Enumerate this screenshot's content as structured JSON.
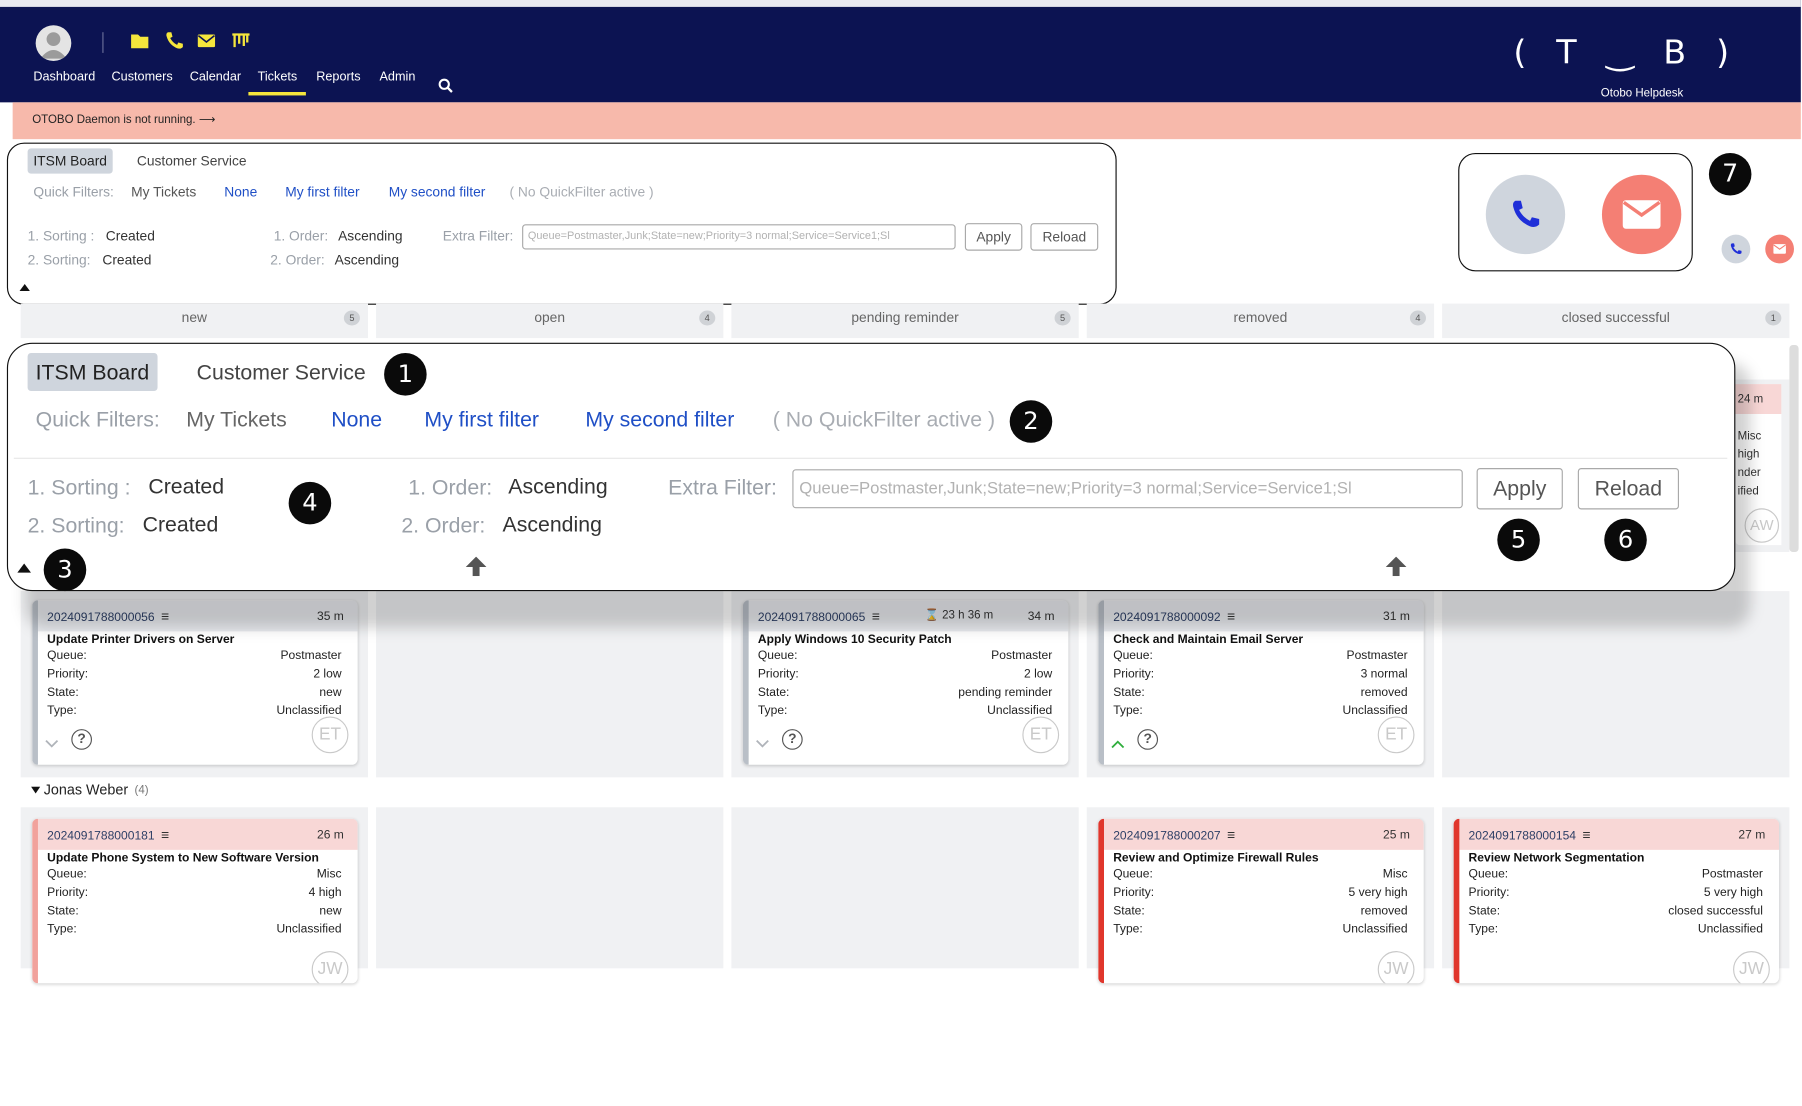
{
  "header": {
    "nav": [
      "Dashboard",
      "Customers",
      "Calendar",
      "Tickets",
      "Reports",
      "Admin"
    ],
    "active_nav": "Tickets",
    "logo_text": "(T‿B)",
    "brand": "Otobo Helpdesk"
  },
  "notice": "OTOBO Daemon is not running. ⟶",
  "toolbar": {
    "tabs": [
      "ITSM Board",
      "Customer Service"
    ],
    "quick_filters_label": "Quick Filters:",
    "quick_filters": [
      "My Tickets",
      "None",
      "My first filter",
      "My second filter"
    ],
    "quick_filter_status": "( No QuickFilter active )",
    "sorting1_label": "1. Sorting :",
    "sorting1_value": "Created",
    "sorting2_label": "2. Sorting:",
    "sorting2_value": "Created",
    "order1_label": "1. Order:",
    "order1_value": "Ascending",
    "order2_label": "2. Order:",
    "order2_value": "Ascending",
    "extra_filter_label": "Extra Filter:",
    "extra_filter_placeholder": "Queue=Postmaster,Junk;State=new;Priority=3 normal;Service=Service1;Sl",
    "apply": "Apply",
    "reload": "Reload"
  },
  "callouts": [
    "1",
    "2",
    "3",
    "4",
    "5",
    "6",
    "7"
  ],
  "colors": {
    "header_bg": "#0c1352",
    "notice_bg": "#f7b9ab",
    "link": "#1f4fc6",
    "phone_bg": "#cfd5dd",
    "mail_bg": "#f47f74",
    "yellow": "#f5e63c"
  },
  "columns": [
    {
      "name": "new",
      "count": "5"
    },
    {
      "name": "open",
      "count": "4"
    },
    {
      "name": "pending reminder",
      "count": "5"
    },
    {
      "name": "removed",
      "count": "4"
    },
    {
      "name": "closed successful",
      "count": "1"
    }
  ],
  "right_peek": {
    "time": "24 m",
    "queue": "Misc",
    "priority": "high",
    "state": "nder",
    "type": "ified",
    "owner": "AW"
  },
  "group2_name": "Jonas Weber",
  "group2_count": "(4)",
  "field_labels": {
    "queue": "Queue:",
    "priority": "Priority:",
    "state": "State:",
    "type": "Type:"
  },
  "cards_row1": [
    {
      "id": "2024091788000056",
      "age": "35 m",
      "mid": "",
      "title": "Update Printer Drivers on Server",
      "queue": "Postmaster",
      "priority": "2 low",
      "state": "new",
      "type": "Unclassified",
      "owner": "ET"
    },
    {
      "id": "2024091788000065",
      "age": "34 m",
      "mid": "⌛ 23 h 36 m",
      "title": "Apply Windows 10 Security Patch",
      "queue": "Postmaster",
      "priority": "2 low",
      "state": "pending reminder",
      "type": "Unclassified",
      "owner": "ET"
    },
    {
      "id": "2024091788000092",
      "age": "31 m",
      "mid": "",
      "title": "Check and Maintain Email Server",
      "queue": "Postmaster",
      "priority": "3 normal",
      "state": "removed",
      "type": "Unclassified",
      "owner": "ET"
    }
  ],
  "cards_row2": [
    {
      "id": "2024091788000181",
      "age": "26 m",
      "title": "Update Phone System to New Software Version",
      "queue": "Misc",
      "priority": "4 high",
      "state": "new",
      "type": "Unclassified",
      "owner": "JW"
    },
    {
      "id": "2024091788000207",
      "age": "25 m",
      "title": "Review and Optimize Firewall Rules",
      "queue": "Misc",
      "priority": "5 very high",
      "state": "removed",
      "type": "Unclassified",
      "owner": "JW"
    },
    {
      "id": "2024091788000154",
      "age": "27 m",
      "title": "Review Network Segmentation",
      "queue": "Postmaster",
      "priority": "5 very high",
      "state": "closed successful",
      "type": "Unclassified",
      "owner": "JW"
    }
  ]
}
